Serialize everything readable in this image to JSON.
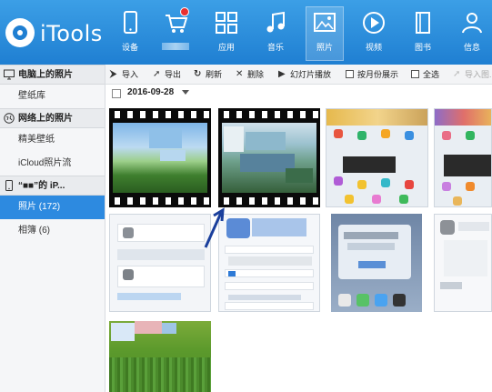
{
  "app": {
    "name": "iTools"
  },
  "nav": [
    {
      "label": "设备",
      "icon": "device-icon"
    },
    {
      "label": "",
      "icon": "store-icon",
      "badge": true
    },
    {
      "label": "应用",
      "icon": "apps-icon"
    },
    {
      "label": "音乐",
      "icon": "music-icon"
    },
    {
      "label": "照片",
      "icon": "photo-icon",
      "active": true
    },
    {
      "label": "视频",
      "icon": "video-icon"
    },
    {
      "label": "图书",
      "icon": "book-icon"
    },
    {
      "label": "信息",
      "icon": "contact-icon"
    }
  ],
  "sidebar": {
    "sections": [
      {
        "title": "电脑上的照片",
        "icon": "computer-icon",
        "items": [
          "壁纸库"
        ]
      },
      {
        "title": "网络上的照片",
        "icon": "globe-icon",
        "items": [
          "精美壁纸",
          "iCloud照片流"
        ]
      },
      {
        "title": "“■■”的 iP...",
        "icon": "phone-icon",
        "items": [
          "照片 (172)",
          "相簿 (6)"
        ]
      }
    ],
    "active_item": "照片 (172)"
  },
  "toolbar": {
    "import": "导入",
    "export": "导出",
    "refresh": "刷新",
    "delete": "删除",
    "slideshow": "幻灯片播放",
    "by_month": "按月份展示",
    "select_all": "全选",
    "import_to": "导入图..."
  },
  "date_group": {
    "date": "2016-09-28"
  },
  "colors": {
    "accent": "#2d8ae0",
    "topbar": "#1f7fd2",
    "badge": "#e83030",
    "arrow": "#1a3f9c"
  }
}
